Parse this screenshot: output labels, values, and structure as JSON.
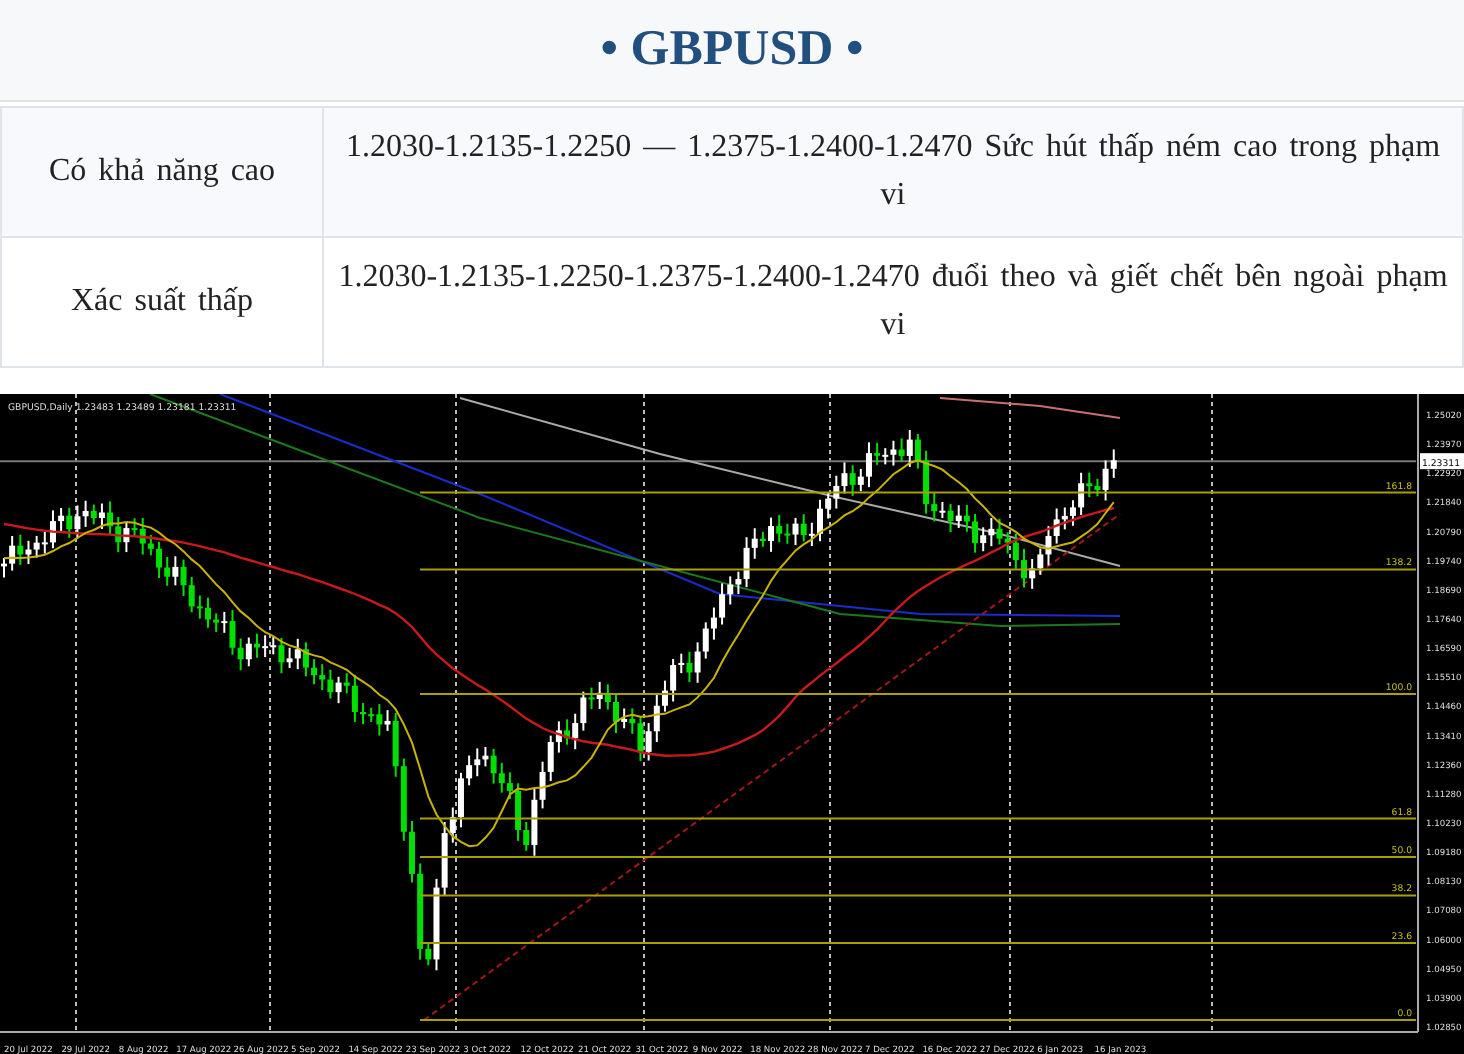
{
  "title": "• GBPUSD •",
  "table": {
    "rows": [
      {
        "label": "Có khả năng cao",
        "text": "1.2030-1.2135-1.2250 — 1.2375-1.2400-1.2470 Sức hút thấp ném cao trong phạm vi"
      },
      {
        "label": "Xác suất thấp",
        "text": "1.2030-1.2135-1.2250-1.2375-1.2400-1.2470 đuổi theo và giết chết bên ngoài phạm vi"
      }
    ]
  },
  "chart": {
    "info": "GBPUSD,Daily 1.23483 1.23489 1.23181 1.23311",
    "current_price": "1.23311",
    "price_axis": [
      "1.25020",
      "1.23970",
      "1.22920",
      "1.21840",
      "1.20790",
      "1.19740",
      "1.18690",
      "1.17640",
      "1.16590",
      "1.15510",
      "1.14460",
      "1.13410",
      "1.12360",
      "1.11280",
      "1.10230",
      "1.09180",
      "1.08130",
      "1.07080",
      "1.06000",
      "1.04950",
      "1.03900",
      "1.02850"
    ],
    "date_axis": [
      "20 Jul 2022",
      "29 Jul 2022",
      "8 Aug 2022",
      "17 Aug 2022",
      "26 Aug 2022",
      "5 Sep 2022",
      "14 Sep 2022",
      "23 Sep 2022",
      "3 Oct 2022",
      "12 Oct 2022",
      "21 Oct 2022",
      "31 Oct 2022",
      "9 Nov 2022",
      "18 Nov 2022",
      "28 Nov 2022",
      "7 Dec 2022",
      "16 Dec 2022",
      "27 Dec 2022",
      "6 Jan 2023",
      "16 Jan 2023"
    ],
    "fib_levels": [
      "161.8",
      "138.2",
      "100.0",
      "61.8",
      "50.0",
      "38.2",
      "23.6",
      "0.0"
    ]
  }
}
